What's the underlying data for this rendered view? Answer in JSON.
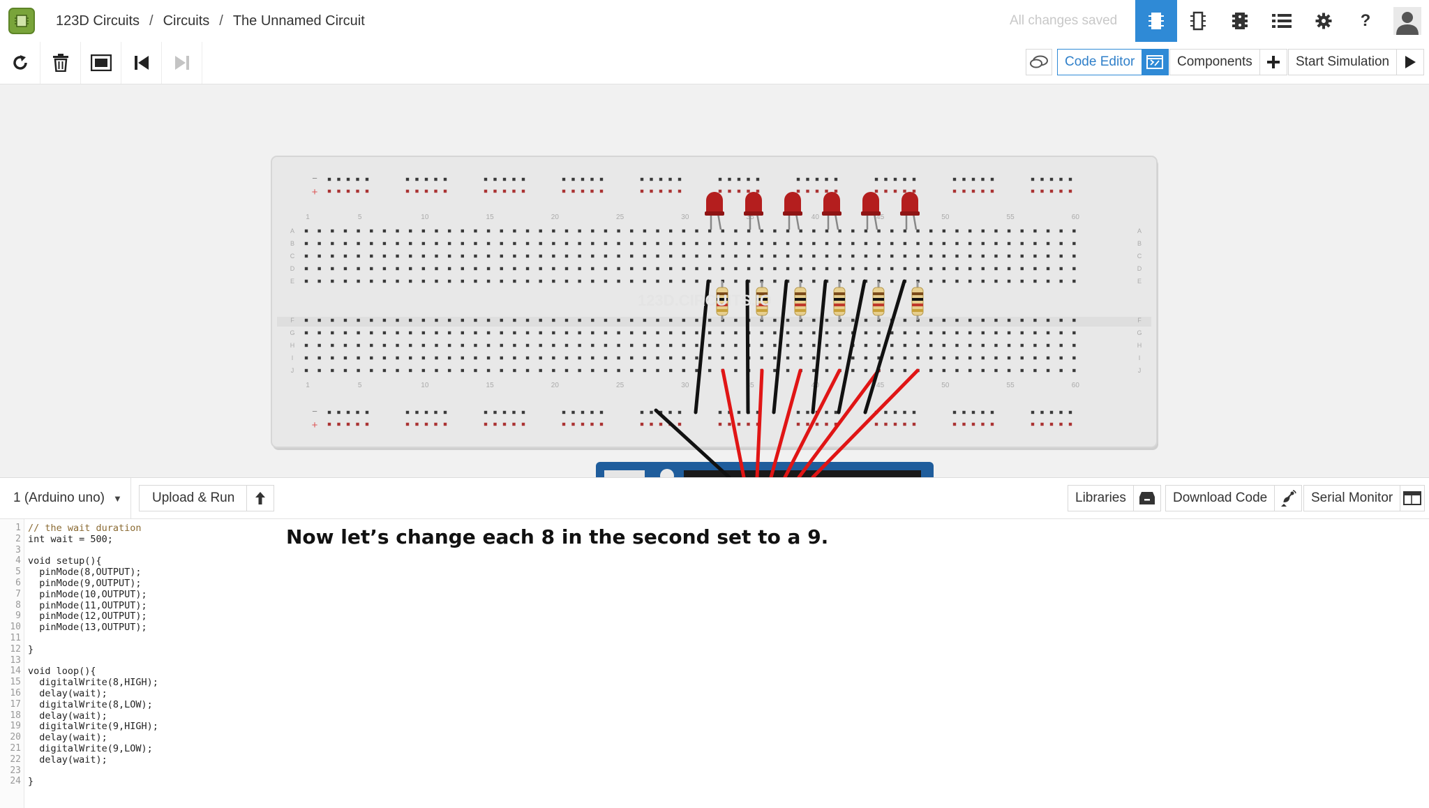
{
  "header": {
    "breadcrumb": [
      "123D Circuits",
      "Circuits",
      "The Unnamed Circuit"
    ],
    "save_status": "All changes saved",
    "icons": [
      "breadboard-view-icon",
      "schematic-view-icon",
      "pcb-view-icon",
      "list-icon",
      "gear-icon",
      "help-icon",
      "user-avatar-icon"
    ]
  },
  "toolbar": {
    "tools": [
      "rotate-icon",
      "delete-icon",
      "fit-to-screen-icon",
      "step-back-icon",
      "step-forward-icon"
    ],
    "code_editor_label": "Code Editor",
    "components_label": "Components",
    "start_simulation_label": "Start Simulation"
  },
  "canvas": {
    "watermark": "123D.CIRCUITS.IO",
    "column_numbers": [
      "1",
      "5",
      "10",
      "15",
      "20",
      "25",
      "30",
      "35",
      "40",
      "45",
      "50",
      "55",
      "60"
    ],
    "row_letters_top": [
      "A",
      "B",
      "C",
      "D",
      "E"
    ],
    "row_letters_bottom": [
      "F",
      "G",
      "H",
      "I",
      "J"
    ],
    "rail_symbols": [
      "−",
      "+"
    ],
    "led_count": 6,
    "resistor_count": 6,
    "colors": {
      "led": "#b41e1e",
      "wire_black": "#111111",
      "wire_red": "#e01515",
      "arduino": "#1f5d9c",
      "active_tab": "#2f8ad6"
    }
  },
  "editor_bar": {
    "board_select": "1 (Arduino uno)",
    "upload_label": "Upload & Run",
    "libraries_label": "Libraries",
    "download_label": "Download Code",
    "serial_label": "Serial Monitor"
  },
  "code": {
    "lines": [
      "// the wait duration",
      "int wait = 500;",
      "",
      "void setup(){",
      "  pinMode(8,OUTPUT);",
      "  pinMode(9,OUTPUT);",
      "  pinMode(10,OUTPUT);",
      "  pinMode(11,OUTPUT);",
      "  pinMode(12,OUTPUT);",
      "  pinMode(13,OUTPUT);",
      "",
      "}",
      "",
      "void loop(){",
      "  digitalWrite(8,HIGH);",
      "  delay(wait);",
      "  digitalWrite(8,LOW);",
      "  delay(wait);",
      "  digitalWrite(9,HIGH);",
      "  delay(wait);",
      "  digitalWrite(9,LOW);",
      "  delay(wait);",
      "",
      "}"
    ],
    "line_numbers": [
      "1",
      "2",
      "3",
      "4",
      "5",
      "6",
      "7",
      "8",
      "9",
      "10",
      "11",
      "12",
      "13",
      "14",
      "15",
      "16",
      "17",
      "18",
      "19",
      "20",
      "21",
      "22",
      "23",
      "24"
    ]
  },
  "instruction": "Now let’s change each 8 in the second set to a 9."
}
